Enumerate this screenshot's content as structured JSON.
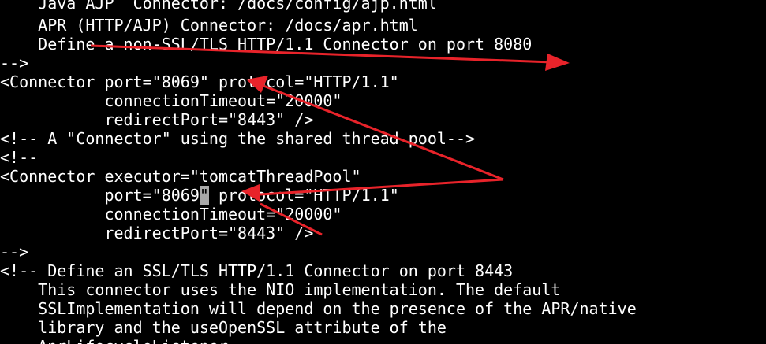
{
  "editor": {
    "lines": [
      "    Java AJP  Connector: /docs/config/ajp.html",
      "    APR (HTTP/AJP) Connector: /docs/apr.html",
      "    Define a non-SSL/TLS HTTP/1.1 Connector on port 8080",
      "-->",
      "<Connector port=\"8069\" protocol=\"HTTP/1.1\"",
      "           connectionTimeout=\"20000\"",
      "           redirectPort=\"8443\" />",
      "<!-- A \"Connector\" using the shared thread pool-->",
      "<!--",
      "<Connector executor=\"tomcatThreadPool\"",
      "           port=\"8069",
      "\"",
      " protocol=\"HTTP/1.1\"",
      "           connectionTimeout=\"20000\"",
      "           redirectPort=\"8443\" />",
      "-->",
      "<!-- Define an SSL/TLS HTTP/1.1 Connector on port 8443",
      "    This connector uses the NIO implementation. The default",
      "    SSLImplementation will depend on the presence of the APR/native",
      "    library and the useOpenSSL attribute of the",
      "    AprLifecycleListener."
    ]
  },
  "annotations": {
    "arrow_color": "#e8232a",
    "arrow_count": 4
  }
}
